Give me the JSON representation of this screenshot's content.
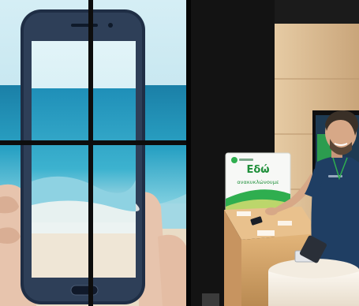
{
  "scene": {
    "sign": {
      "title": "Εδώ",
      "subtitle": "ανακυκλώνουμε"
    },
    "colors": {
      "accent_green": "#2fae4f",
      "ocean": "#2e9bc2",
      "sky": "#bfe3ee",
      "counter_wood": "#d7b07a",
      "shirt_navy": "#1f3e63"
    }
  }
}
